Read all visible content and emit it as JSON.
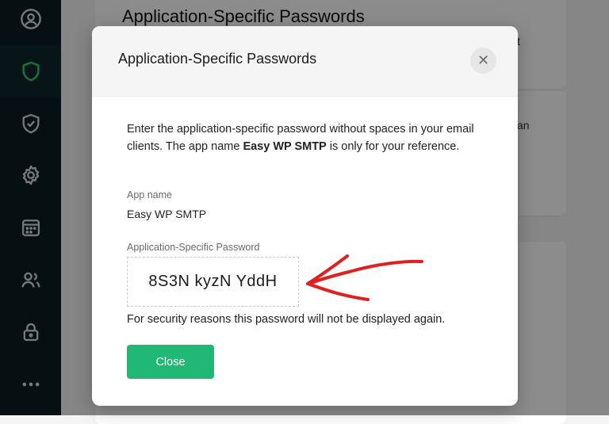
{
  "sidebar": {
    "items": [
      {
        "icon": "user-circle-icon"
      },
      {
        "icon": "shield-icon",
        "active": true
      },
      {
        "icon": "shield-check-icon"
      },
      {
        "icon": "gear-icon"
      },
      {
        "icon": "calendar-icon"
      },
      {
        "icon": "users-icon"
      },
      {
        "icon": "lock-icon"
      },
      {
        "icon": "more-dots-icon"
      }
    ],
    "accent_color": "#2ecc71",
    "icon_color": "#d6dde0"
  },
  "background": {
    "card_title": "Application-Specific Passwords",
    "frag_1": "t",
    "frag_2": "an"
  },
  "modal": {
    "title": "Application-Specific Passwords",
    "close_icon": "close-icon",
    "description_before": "Enter the application-specific password without spaces in your email clients. The app name ",
    "description_app": "Easy WP SMTP",
    "description_after": " is only for your reference.",
    "app_name_label": "App name",
    "app_name_value": "Easy WP SMTP",
    "password_label": "Application-Specific Password",
    "password_value": "8S3N kyzN YddH",
    "security_note": "For security reasons this password will not be displayed again.",
    "close_button_label": "Close",
    "close_button_color": "#21b774"
  },
  "annotation": {
    "arrow_color": "#e02020"
  }
}
